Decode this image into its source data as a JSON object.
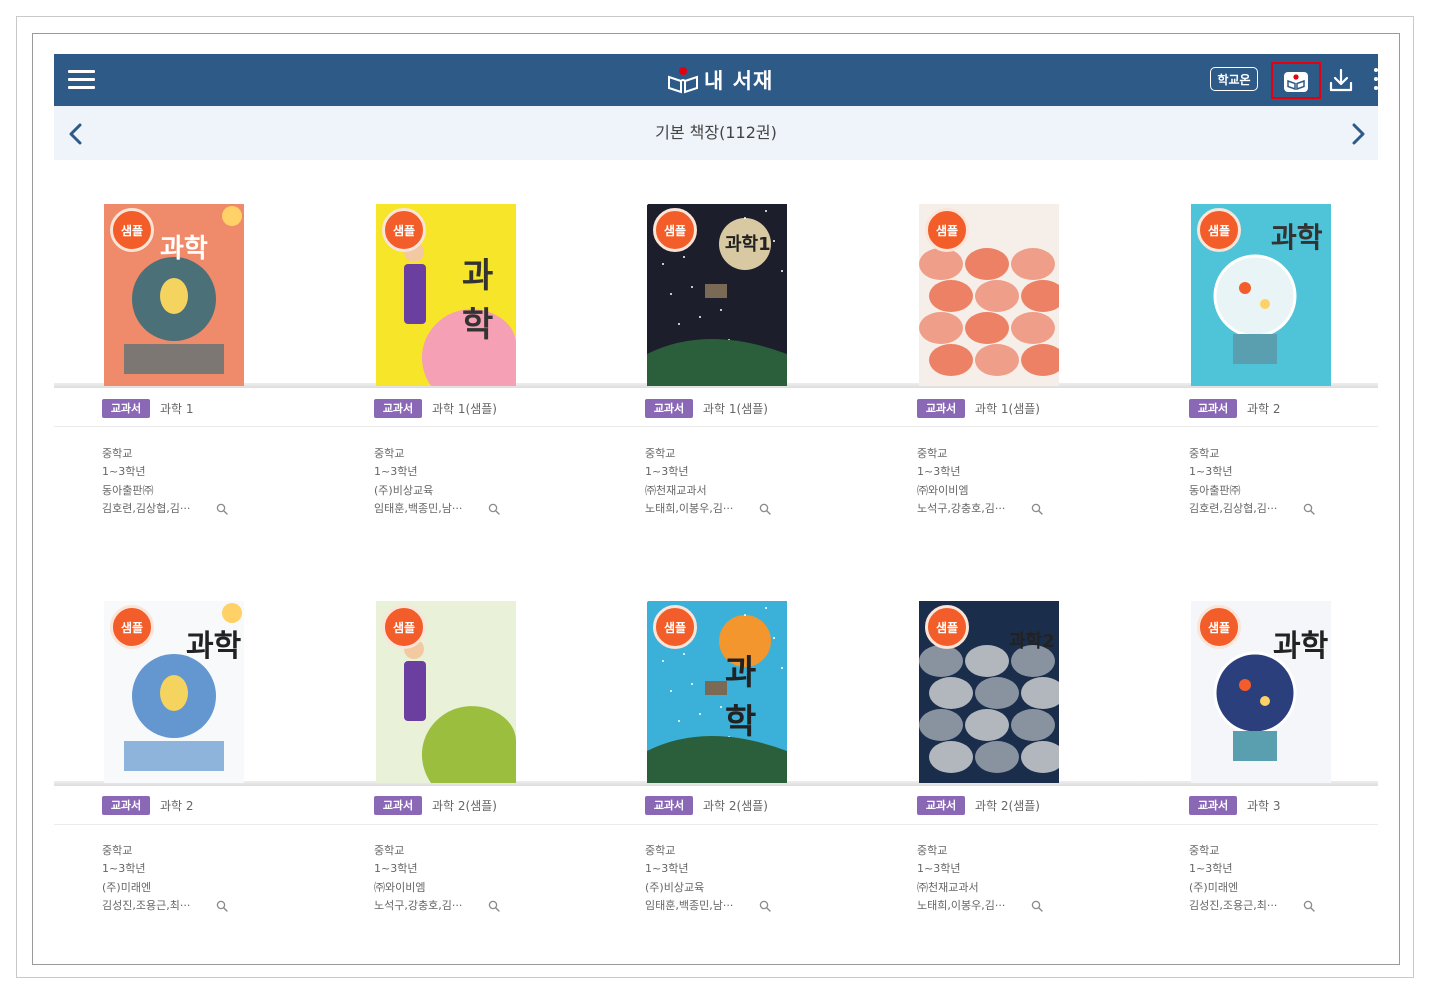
{
  "header": {
    "title": "내 서재",
    "school_button": "학교온",
    "colors": {
      "bar": "#2e5a87",
      "highlight": "#e3000f"
    }
  },
  "shelf": {
    "title": "기본 책장(112권)"
  },
  "books": [
    {
      "sample": "샘플",
      "cover_title": "과학",
      "tag": "교과서",
      "name": "과학 1",
      "level": "중학교",
      "grade": "1~3학년",
      "publisher": "동아출판㈜",
      "authors": "김호련,김상협,김···"
    },
    {
      "sample": "샘플",
      "cover_title": "과학",
      "tag": "교과서",
      "name": "과학 1(샘플)",
      "level": "중학교",
      "grade": "1~3학년",
      "publisher": "(주)비상교육",
      "authors": "임태훈,백종민,남···"
    },
    {
      "sample": "샘플",
      "cover_title": "과학1",
      "tag": "교과서",
      "name": "과학 1(샘플)",
      "level": "중학교",
      "grade": "1~3학년",
      "publisher": "㈜천재교과서",
      "authors": "노태희,이봉우,김···"
    },
    {
      "sample": "샘플",
      "cover_title": "",
      "tag": "교과서",
      "name": "과학 1(샘플)",
      "level": "중학교",
      "grade": "1~3학년",
      "publisher": "㈜와이비엠",
      "authors": "노석구,강충호,김···"
    },
    {
      "sample": "샘플",
      "cover_title": "과학",
      "tag": "교과서",
      "name": "과학 2",
      "level": "중학교",
      "grade": "1~3학년",
      "publisher": "동아출판㈜",
      "authors": "김호련,김상협,김···"
    },
    {
      "sample": "샘플",
      "cover_title": "과학",
      "tag": "교과서",
      "name": "과학 2",
      "level": "중학교",
      "grade": "1~3학년",
      "publisher": "(주)미래엔",
      "authors": "김성진,조용근,최···"
    },
    {
      "sample": "샘플",
      "cover_title": "",
      "tag": "교과서",
      "name": "과학 2(샘플)",
      "level": "중학교",
      "grade": "1~3학년",
      "publisher": "㈜와이비엠",
      "authors": "노석구,강충호,김···"
    },
    {
      "sample": "샘플",
      "cover_title": "과학",
      "tag": "교과서",
      "name": "과학 2(샘플)",
      "level": "중학교",
      "grade": "1~3학년",
      "publisher": "(주)비상교육",
      "authors": "임태훈,백종민,남···"
    },
    {
      "sample": "샘플",
      "cover_title": "과학2",
      "tag": "교과서",
      "name": "과학 2(샘플)",
      "level": "중학교",
      "grade": "1~3학년",
      "publisher": "㈜천재교과서",
      "authors": "노태희,이봉우,김···"
    },
    {
      "sample": "샘플",
      "cover_title": "과학",
      "tag": "교과서",
      "name": "과학 3",
      "level": "중학교",
      "grade": "1~3학년",
      "publisher": "(주)미래엔",
      "authors": "김성진,조용근,최···"
    }
  ],
  "covers": [
    {
      "bg": "#ef8a6a",
      "accent": "#2f6b7a",
      "text": "#ffffff"
    },
    {
      "bg": "#f7e52a",
      "accent": "#f5a0b4",
      "text": "#333333"
    },
    {
      "bg": "#1c1f2b",
      "accent": "#d9c9a3",
      "text": "#222222"
    },
    {
      "bg": "#f6eee8",
      "accent": "#e85c3a",
      "text": "#333333"
    },
    {
      "bg": "#4fc3d8",
      "accent": "#e9f4f7",
      "text": "#333333"
    },
    {
      "bg": "#f7f9fb",
      "accent": "#4a86c8",
      "text": "#222222"
    },
    {
      "bg": "#e9f2d8",
      "accent": "#9bbe3e",
      "text": "#333333"
    },
    {
      "bg": "#3bb0d8",
      "accent": "#f2962d",
      "text": "#222222"
    },
    {
      "bg": "#1a2d4a",
      "accent": "#e6e6e6",
      "text": "#222222"
    },
    {
      "bg": "#f4f6fa",
      "accent": "#2a3f7c",
      "text": "#222222"
    }
  ]
}
